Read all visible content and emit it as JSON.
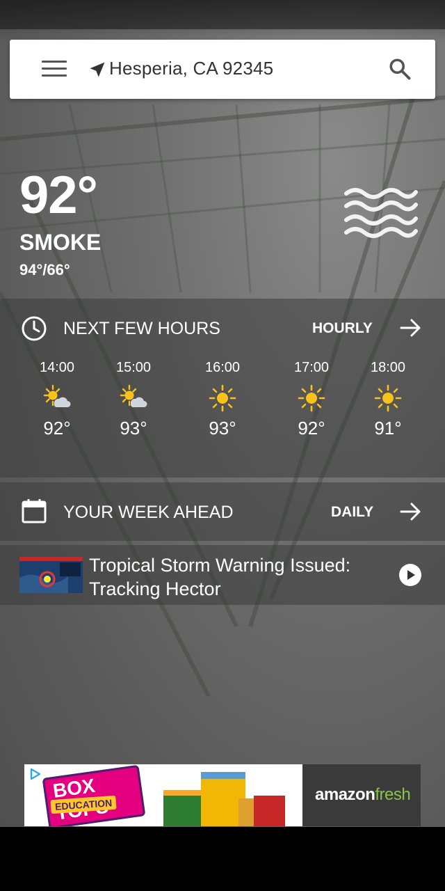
{
  "search": {
    "location": "Hesperia, CA 92345"
  },
  "current": {
    "temperature": "92°",
    "condition": "SMOKE",
    "high_low": "94°/66°"
  },
  "hourly_section": {
    "title": "NEXT FEW HOURS",
    "link_label": "HOURLY",
    "hours": [
      {
        "time": "14:00",
        "icon": "partly-sunny-icon",
        "temp": "92°"
      },
      {
        "time": "15:00",
        "icon": "partly-sunny-icon",
        "temp": "93°"
      },
      {
        "time": "16:00",
        "icon": "sunny-icon",
        "temp": "93°"
      },
      {
        "time": "17:00",
        "icon": "sunny-icon",
        "temp": "92°"
      },
      {
        "time": "18:00",
        "icon": "sunny-icon",
        "temp": "91°"
      }
    ]
  },
  "week_section": {
    "title": "YOUR WEEK AHEAD",
    "link_label": "DAILY"
  },
  "news": {
    "title": "Tropical Storm Warning Issued: Tracking Hector"
  },
  "ad": {
    "left_text_top": "BOX TOPS",
    "left_text_bottom": "EDUCATION",
    "brand_main": "amazon",
    "brand_accent": "fresh"
  },
  "colors": {
    "sun": "#f7c21a",
    "panel": "#3c3c3c",
    "accent_fresh": "#8bc34a"
  }
}
